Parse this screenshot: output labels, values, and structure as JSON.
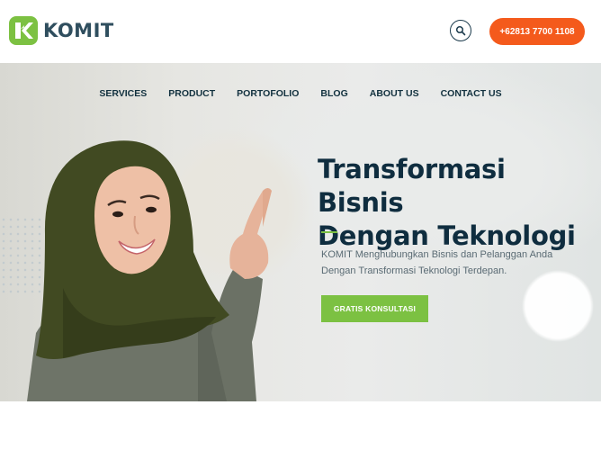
{
  "brand": {
    "name": "KOMIT",
    "accent": "#7cc142",
    "dark": "#0f2d3f",
    "orange": "#f45a1c"
  },
  "header": {
    "phone": "+62813 7700 1108",
    "search_icon": "search-icon"
  },
  "nav": {
    "items": [
      "SERVICES",
      "PRODUCT",
      "PORTOFOLIO",
      "BLOG",
      "ABOUT US",
      "CONTACT US"
    ]
  },
  "hero": {
    "title_line1": "Transformasi Bisnis",
    "title_line2": "Dengan Teknologi",
    "subtitle_line1": "KOMIT Menghubungkan Bisnis dan Pelanggan Anda",
    "subtitle_line2": "Dengan Transformasi Teknologi Terdepan.",
    "cta_label": "GRATIS KONSULTASI"
  }
}
